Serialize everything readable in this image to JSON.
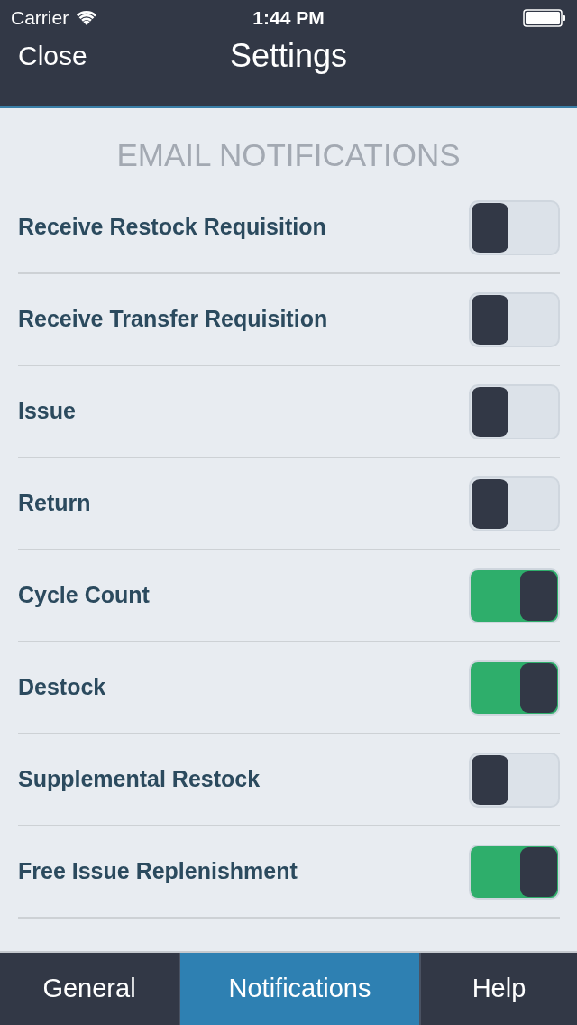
{
  "status_bar": {
    "carrier": "Carrier",
    "time": "1:44 PM"
  },
  "nav_bar": {
    "left_button": "Close",
    "title": "Settings"
  },
  "section": {
    "title": "EMAIL NOTIFICATIONS"
  },
  "settings": [
    {
      "label": "Receive Restock Requisition",
      "on": false
    },
    {
      "label": "Receive Transfer Requisition",
      "on": false
    },
    {
      "label": "Issue",
      "on": false
    },
    {
      "label": "Return",
      "on": false
    },
    {
      "label": "Cycle Count",
      "on": true
    },
    {
      "label": "Destock",
      "on": true
    },
    {
      "label": "Supplemental Restock",
      "on": false
    },
    {
      "label": "Free Issue Replenishment",
      "on": true
    }
  ],
  "tabs": [
    {
      "label": "General",
      "selected": false
    },
    {
      "label": "Notifications",
      "selected": true
    },
    {
      "label": "Help",
      "selected": false
    }
  ]
}
